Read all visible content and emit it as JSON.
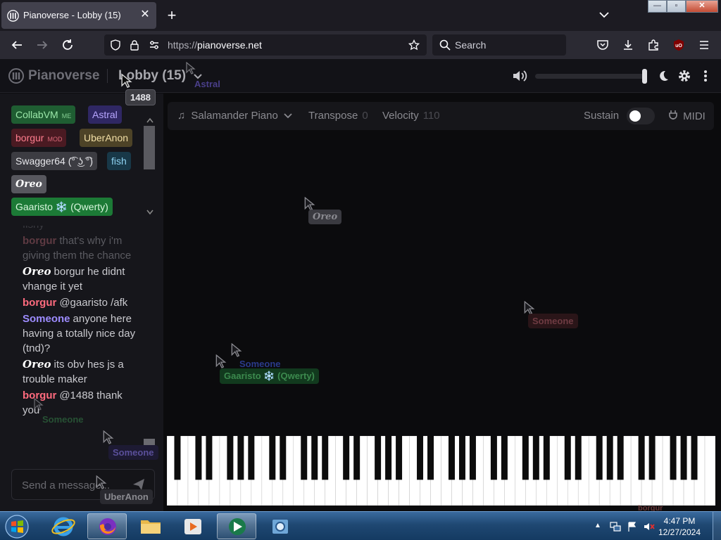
{
  "browser": {
    "tab_title": "Pianoverse - Lobby (15)",
    "url_protocol": "https://",
    "url_host": "pianoverse.net",
    "search_placeholder": "Search",
    "close_glyph": "✕",
    "new_tab_glyph": "+",
    "win_min": "—",
    "win_max": "▫",
    "win_close": "✕",
    "ublock_label": "uO"
  },
  "header": {
    "app_name": "Pianoverse",
    "room_title": "Lobby (15)"
  },
  "users": [
    {
      "name": "CollabVM",
      "badge": "ME",
      "bg": "#1f5d32",
      "fg": "#9be7a9"
    },
    {
      "name": "Astral",
      "badge": "",
      "bg": "#2f2763",
      "fg": "#b7a6ff"
    },
    {
      "name": "borgur",
      "badge": "MOD",
      "bg": "#4a1a22",
      "fg": "#ff7d8e"
    },
    {
      "name": "UberAnon",
      "badge": "",
      "bg": "#4d4327",
      "fg": "#f2dfa6"
    },
    {
      "name": "Swagger64 (͡° ͜ʖ ͡°)",
      "badge": "",
      "bg": "#3c3c42",
      "fg": "#e6e6ea"
    },
    {
      "name": "fish",
      "badge": "",
      "bg": "#183848",
      "fg": "#8fd3f2"
    },
    {
      "name": "Oreo",
      "badge": "",
      "bg": "#57575e",
      "fg": "#ffffff"
    },
    {
      "name": "Gaaristo ❄️ (Qwerty)",
      "badge": "",
      "bg": "#1c7a36",
      "fg": "#d8f7dd"
    }
  ],
  "chat": {
    "faded_line": "fishy",
    "messages": [
      {
        "name": "borgur",
        "color": "#5e3a42",
        "text": "that's why i'm giving them the chance",
        "faded": true
      },
      {
        "name": "Oreo",
        "color": "#ffffff",
        "text": "borgur he didnt vhange it yet",
        "faded": false
      },
      {
        "name": "borgur",
        "color": "#ff6b7e",
        "text": "@gaaristo /afk",
        "faded": false
      },
      {
        "name": "Someone",
        "color": "#9d8cff",
        "text": "anyone here having a totally nice day (tnd)?",
        "faded": false
      },
      {
        "name": "Oreo",
        "color": "#ffffff",
        "text": "its obv hes js a trouble maker",
        "faded": false
      },
      {
        "name": "borgur",
        "color": "#ff6b7e",
        "text": "@1488 thank you",
        "faded": false
      }
    ],
    "input_placeholder": "Send a message..."
  },
  "controls": {
    "instrument": "Salamander Piano",
    "transpose_label": "Transpose",
    "transpose_value": "0",
    "velocity_label": "Velocity",
    "velocity_value": "110",
    "sustain_label": "Sustain",
    "midi_label": "MIDI"
  },
  "cursors": {
    "astral": "Astral",
    "tooltip_1488": "1488",
    "oreo": "Oreo",
    "someone_right": "Someone",
    "someone_mid": "Someone",
    "gaaristo": "Gaaristo ❄️ (Qwerty)",
    "someone_chat": "Someone",
    "someone_side": "Someone",
    "uberanon": "UberAnon",
    "borgur_piano": "borgur"
  },
  "taskbar": {
    "time": "4:47 PM",
    "date": "12/27/2024"
  },
  "colors": {
    "accent_green": "#1c7a36",
    "pressed_key": "#c8a868"
  }
}
